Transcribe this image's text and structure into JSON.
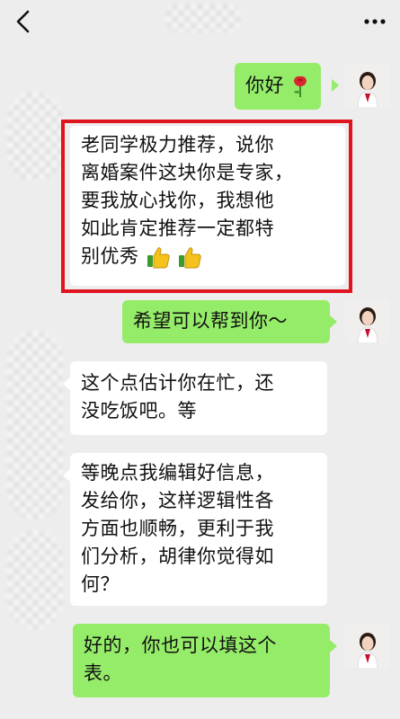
{
  "header": {
    "back_icon": "chevron-left-icon",
    "more_icon": "more-dots-icon"
  },
  "messages": [
    {
      "side": "right",
      "text": "你好",
      "emoji": "rose-icon"
    },
    {
      "side": "left",
      "text_lines": [
        "老同学极力推荐，说你",
        "离婚案件这块你是专家，",
        "要我放心找你，我想他",
        "如此肯定推荐一定都特",
        "别优秀"
      ],
      "emoji": "thumbs-up-icon",
      "highlighted": true
    },
    {
      "side": "right",
      "text": "希望可以帮到你～"
    },
    {
      "side": "left",
      "text_lines": [
        "这个点估计你在忙，还",
        "没吃饭吧。等"
      ]
    },
    {
      "side": "left",
      "text_lines": [
        "等晚点我编辑好信息，",
        "发给你，这样逻辑性各",
        "方面也顺畅，更利于我",
        "们分析，胡律你觉得如",
        "何？"
      ]
    },
    {
      "side": "right",
      "text_lines": [
        "好的，你也可以填这个",
        "表。"
      ]
    }
  ],
  "colors": {
    "background": "#ededed",
    "sent_bubble": "#95ec69",
    "received_bubble": "#ffffff",
    "highlight": "#e0141e"
  }
}
